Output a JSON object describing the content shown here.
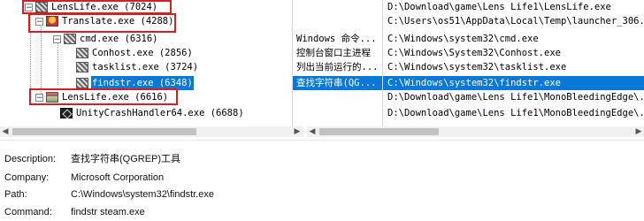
{
  "tree": {
    "rows": [
      {
        "name": "LensLife.exe (7024)",
        "level": 0,
        "expander": "−",
        "icon": "game-tile-icon"
      },
      {
        "name": "Translate.exe (4288)",
        "level": 1,
        "expander": "−",
        "icon": "character-icon"
      },
      {
        "name": "cmd.exe (6316)",
        "level": 2,
        "expander": "−",
        "icon": "console-icon"
      },
      {
        "name": "Conhost.exe (2856)",
        "level": 3,
        "expander": "",
        "icon": "console-icon"
      },
      {
        "name": "tasklist.exe (3724)",
        "level": 3,
        "expander": "",
        "icon": "console-icon"
      },
      {
        "name": "findstr.exe (6348)",
        "level": 3,
        "expander": "",
        "icon": "console-icon",
        "selected": true
      },
      {
        "name": "LensLife.exe (6616)",
        "level": 1,
        "expander": "−",
        "icon": "photo-icon"
      },
      {
        "name": "UnityCrashHandler64.exe (6688)",
        "level": 2,
        "expander": "",
        "icon": "unity-icon"
      }
    ]
  },
  "description_col": [
    "",
    "",
    "Windows 命令...",
    "控制台窗口主进程",
    "列出当前运行的...",
    "查找字符串(QG...",
    "",
    ""
  ],
  "path_col": [
    "D:\\Download\\game\\Lens Life1\\LensLife.exe",
    "C:\\Users\\os51\\AppData\\Local\\Temp\\launcher_306...",
    "C:\\Windows\\system32\\cmd.exe",
    "C:\\Windows\\System32\\Conhost.exe",
    "C:\\Windows\\system32\\tasklist.exe",
    "C:\\Windows\\system32\\findstr.exe",
    "D:\\Download\\game\\Lens Life1\\MonoBleedingEdge\\...",
    "D:\\Download\\game\\Lens Life1\\MonoBleedingEdge\\..."
  ],
  "details": {
    "description_label": "Description:",
    "description_value": "查找字符串(QGREP)工具",
    "company_label": "Company:",
    "company_value": "Microsoft Corporation",
    "path_label": "Path:",
    "path_value": "C:\\Windows\\system32\\findstr.exe",
    "command_label": "Command:",
    "command_value": "findstr  steam.exe"
  },
  "colors": {
    "selection": "#0a78d7",
    "highlight_box": "#d32026"
  }
}
